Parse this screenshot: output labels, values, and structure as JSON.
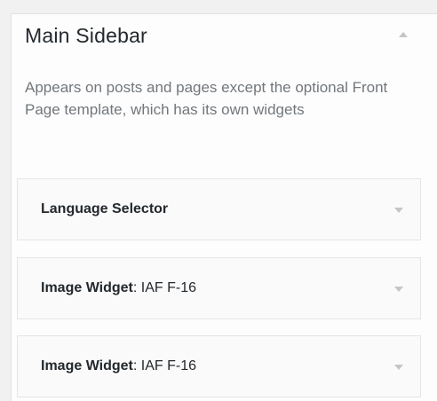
{
  "sidebar": {
    "title": "Main Sidebar",
    "description": "Appears on posts and pages except the optional Front Page template, which has its own widgets",
    "collapse_icon": "arrow-up-icon"
  },
  "widgets": [
    {
      "title": "Language Selector",
      "subtitle": "",
      "toggle_icon": "arrow-down-icon"
    },
    {
      "title": "Image Widget",
      "subtitle": ": IAF F-16",
      "toggle_icon": "arrow-down-icon"
    },
    {
      "title": "Image Widget",
      "subtitle": ": IAF F-16",
      "toggle_icon": "arrow-down-icon"
    }
  ],
  "colors": {
    "background": "#f1f1f1",
    "panel": "#fdfdfd",
    "widget_bg": "#fafafa",
    "border": "#e5e5e5",
    "text": "#23282d",
    "muted_text": "#72777c",
    "icon": "#c5c5c5"
  }
}
